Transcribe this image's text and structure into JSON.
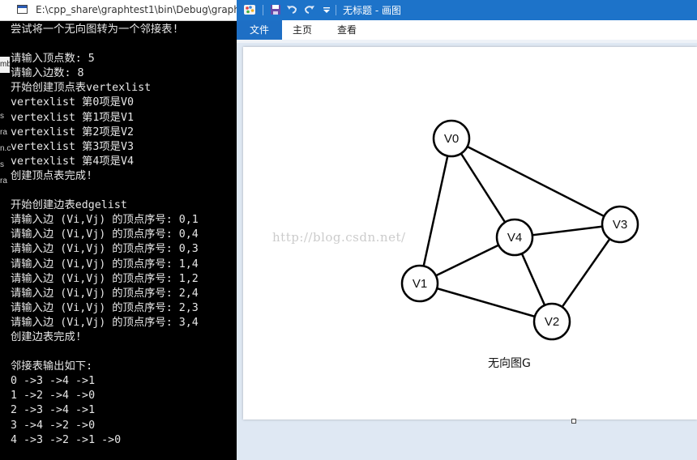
{
  "console": {
    "title": "E:\\cpp_share\\graphtest1\\bin\\Debug\\graph",
    "side_fragments": [
      "mb",
      "s",
      "ra",
      "n.c",
      "s",
      "ra"
    ],
    "lines": [
      "尝试将一个无向图转为一个邻接表!",
      "",
      "请输入顶点数: 5",
      "请输入边数: 8",
      "开始创建顶点表vertexlist",
      "vertexlist 第0项是V0",
      "vertexlist 第1项是V1",
      "vertexlist 第2项是V2",
      "vertexlist 第3项是V3",
      "vertexlist 第4项是V4",
      "创建顶点表完成!",
      "",
      "开始创建边表edgelist",
      "请输入边 (Vi,Vj) 的顶点序号: 0,1",
      "请输入边 (Vi,Vj) 的顶点序号: 0,4",
      "请输入边 (Vi,Vj) 的顶点序号: 0,3",
      "请输入边 (Vi,Vj) 的顶点序号: 1,4",
      "请输入边 (Vi,Vj) 的顶点序号: 1,2",
      "请输入边 (Vi,Vj) 的顶点序号: 2,4",
      "请输入边 (Vi,Vj) 的顶点序号: 2,3",
      "请输入边 (Vi,Vj) 的顶点序号: 3,4",
      "创建边表完成!",
      "",
      "邻接表输出如下:",
      "0 ->3 ->4 ->1",
      "1 ->2 ->4 ->0",
      "2 ->3 ->4 ->1",
      "3 ->4 ->2 ->0",
      "4 ->3 ->2 ->1 ->0"
    ]
  },
  "paint": {
    "title": "无标题 - 画图",
    "tabs": {
      "file": "文件",
      "home": "主页",
      "view": "查看"
    },
    "accent_color": "#1d73c9",
    "quick_access_icons": [
      "paint-icon",
      "save-icon",
      "undo-icon",
      "redo-icon",
      "dropdown-icon"
    ],
    "canvas": {
      "caption": "无向图G",
      "watermark": "http://blog.csdn.net/",
      "nodes": [
        {
          "id": "V0",
          "label": "V0"
        },
        {
          "id": "V1",
          "label": "V1"
        },
        {
          "id": "V2",
          "label": "V2"
        },
        {
          "id": "V3",
          "label": "V3"
        },
        {
          "id": "V4",
          "label": "V4"
        }
      ],
      "edges": [
        [
          "V0",
          "V1"
        ],
        [
          "V0",
          "V4"
        ],
        [
          "V0",
          "V3"
        ],
        [
          "V1",
          "V4"
        ],
        [
          "V1",
          "V2"
        ],
        [
          "V2",
          "V4"
        ],
        [
          "V2",
          "V3"
        ],
        [
          "V3",
          "V4"
        ]
      ]
    }
  }
}
